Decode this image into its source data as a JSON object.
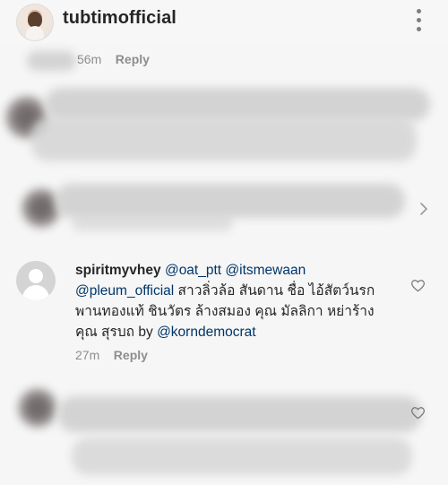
{
  "header": {
    "username": "tubtimofficial",
    "more_icon": "more-vertical-icon"
  },
  "comments": [
    {
      "time": "56m",
      "reply_label": "Reply"
    },
    {
      "username": "spiritmyvhey",
      "mentions": [
        "@oat_ptt",
        "@itsmewaan",
        "@pleum_official"
      ],
      "text": "สาวลิ่วล้อ สันดาน ชื่อ ไอ้สัตว์นรก พานทองแท้ ชินวัตร ล้างสมอง คุณ มัลลิกา หย่าร้าง คุณ สุรบถ by",
      "tail_mention": "@korndemocrat",
      "time": "27m",
      "reply_label": "Reply"
    }
  ],
  "icons": {
    "heart": "heart-icon",
    "chevron": "chevron-right-icon"
  },
  "colors": {
    "background": "#f6f6f6",
    "text": "#262626",
    "muted": "#8e8e8e",
    "mention": "#003569"
  }
}
